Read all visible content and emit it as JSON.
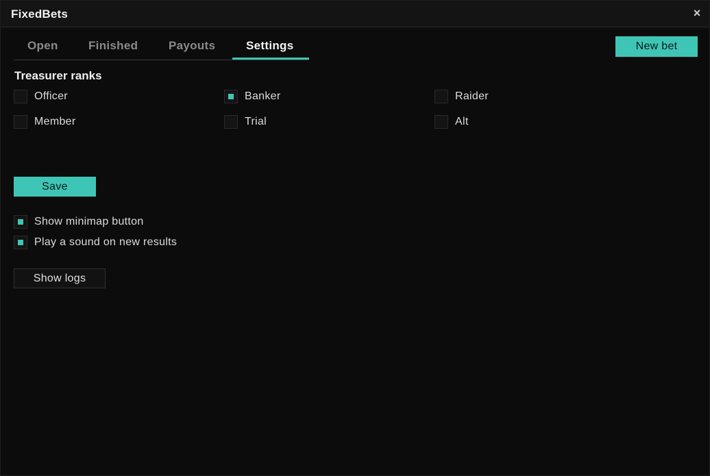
{
  "window": {
    "title": "FixedBets",
    "close_symbol": "×"
  },
  "tabs": [
    {
      "label": "Open",
      "active": false
    },
    {
      "label": "Finished",
      "active": false
    },
    {
      "label": "Payouts",
      "active": false
    },
    {
      "label": "Settings",
      "active": true
    }
  ],
  "header": {
    "new_bet_label": "New bet"
  },
  "treasurer": {
    "title": "Treasurer ranks",
    "ranks": [
      {
        "label": "Officer",
        "checked": false
      },
      {
        "label": "Banker",
        "checked": true
      },
      {
        "label": "Raider",
        "checked": false
      },
      {
        "label": "Member",
        "checked": false
      },
      {
        "label": "Trial",
        "checked": false
      },
      {
        "label": "Alt",
        "checked": false
      }
    ],
    "save_label": "Save"
  },
  "options": [
    {
      "label": "Show minimap button",
      "checked": true
    },
    {
      "label": "Play a sound on new results",
      "checked": true
    }
  ],
  "logs": {
    "show_logs_label": "Show logs"
  },
  "colors": {
    "accent": "#3fc5b5",
    "background": "#0c0c0c"
  }
}
